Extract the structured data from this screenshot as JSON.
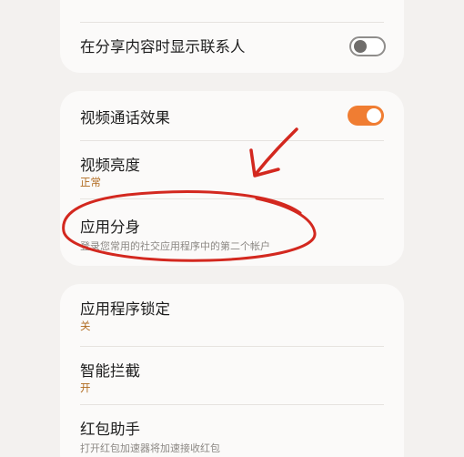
{
  "settings": {
    "share_contact": {
      "title": "在分享内容时显示联系人",
      "toggle": "off"
    },
    "video_call_effects": {
      "title": "视频通话效果",
      "toggle": "on"
    },
    "video_brightness": {
      "title": "视频亮度",
      "value": "正常"
    },
    "dual_apps": {
      "title": "应用分身",
      "description": "登录您常用的社交应用程序中的第二个帐户"
    },
    "app_lock": {
      "title": "应用程序锁定",
      "value": "关"
    },
    "smart_intercept": {
      "title": "智能拦截",
      "value": "开"
    },
    "red_packet": {
      "title": "红包助手",
      "description": "打开红包加速器将加速接收红包"
    }
  },
  "colors": {
    "accent": "#f07d32",
    "value_text": "#b06a1e",
    "annotation": "#d3281f"
  }
}
